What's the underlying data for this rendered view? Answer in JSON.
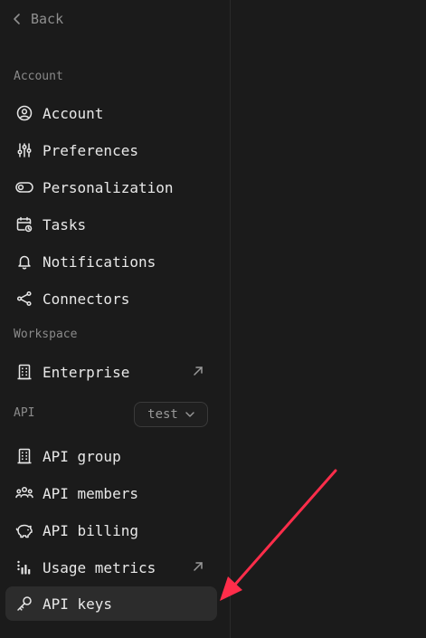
{
  "nav": {
    "back_label": "Back"
  },
  "sections": {
    "account_label": "Account",
    "workspace_label": "Workspace",
    "api_label": "API"
  },
  "items": {
    "account": "Account",
    "preferences": "Preferences",
    "personalization": "Personalization",
    "tasks": "Tasks",
    "notifications": "Notifications",
    "connectors": "Connectors",
    "enterprise": "Enterprise",
    "api_group": "API group",
    "api_members": "API members",
    "api_billing": "API billing",
    "usage_metrics": "Usage metrics",
    "api_keys": "API keys"
  },
  "api_selector": {
    "value": "test"
  },
  "annotation": {
    "color": "#ff2d4a",
    "points_to": "api-keys"
  },
  "colors": {
    "background": "#1b1b1b",
    "active_item": "#2c2c2c",
    "muted_text": "#8a8a8a"
  }
}
